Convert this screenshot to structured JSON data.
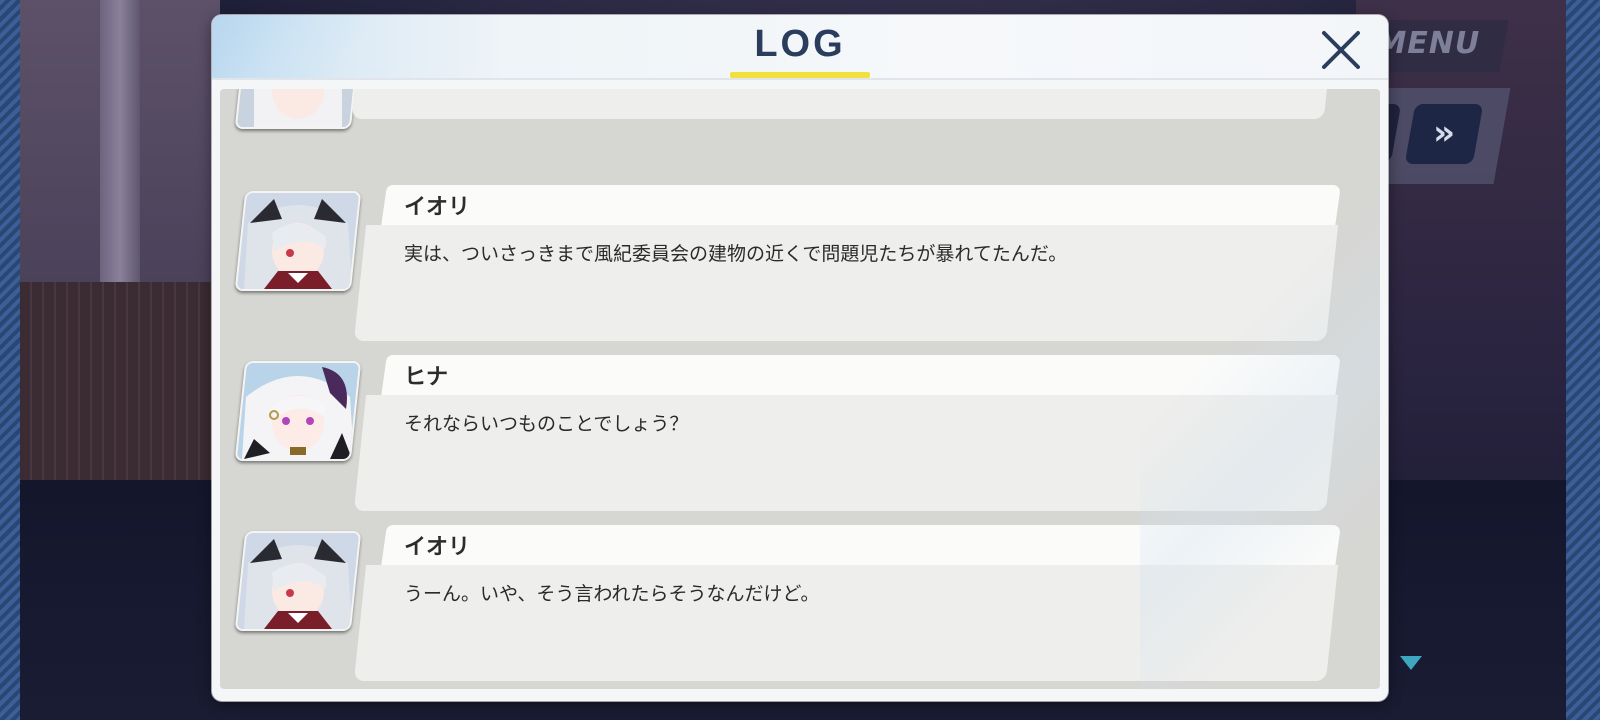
{
  "overlay": {
    "menu_label": "MENU",
    "fast_forward_glyph": "»"
  },
  "log": {
    "title": "LOG",
    "close_glyph": "×",
    "partial_entry_text": "……",
    "entries": [
      {
        "speaker": "イオリ",
        "text": "実は、ついさっきまで風紀委員会の建物の近くで問題児たちが暴れてたんだ。"
      },
      {
        "speaker": "ヒナ",
        "text": "それならいつものことでしょう？"
      },
      {
        "speaker": "イオリ",
        "text": "うーん。いや、そう言われたらそうなんだけど。"
      }
    ]
  },
  "colors": {
    "title": "#2b3d5c",
    "title_underline": "#f4e03c",
    "scroll_bg": "#d6d6d3",
    "body_bar": "#eeeeec",
    "name_bar": "#fbfbfa"
  },
  "icons": {
    "close": "close-x-icon",
    "fast_forward": "fast-forward-icon",
    "next": "next-triangle-icon"
  }
}
